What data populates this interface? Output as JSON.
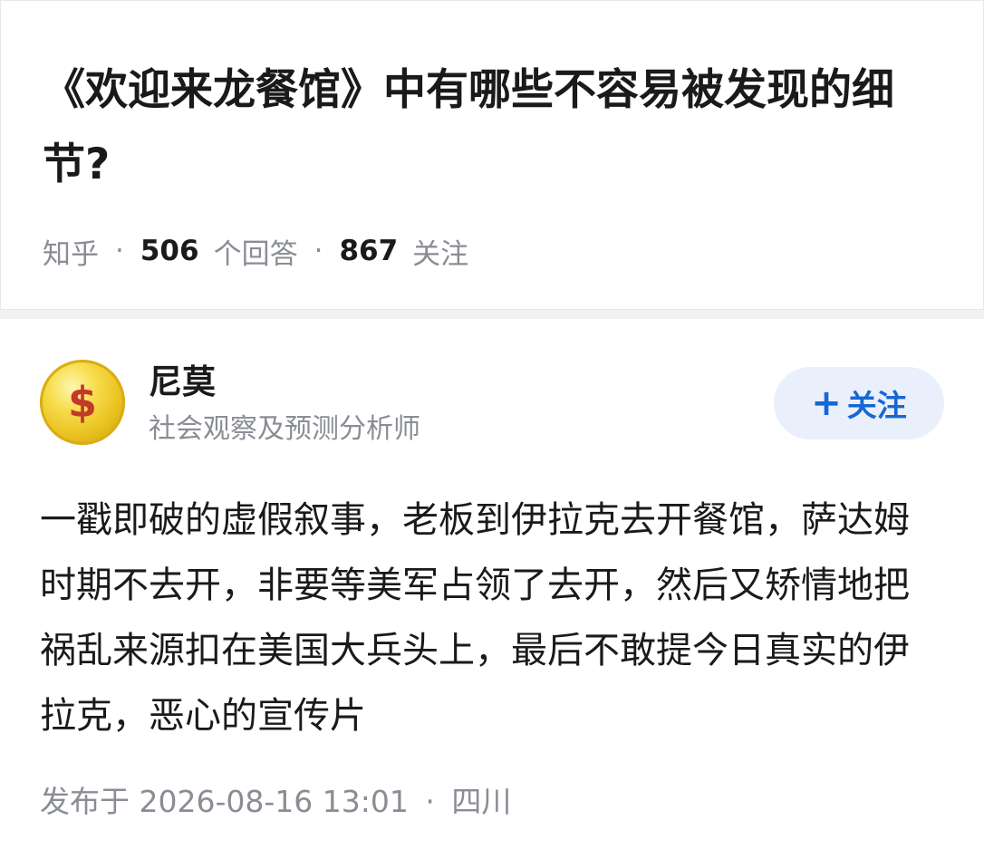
{
  "question": {
    "title": "《欢迎来龙餐馆》中有哪些不容易被发现的细节?",
    "source": "知乎",
    "separator": "·",
    "answer_count": "506",
    "answer_label": "个回答",
    "follow_count": "867",
    "follow_label": "关注"
  },
  "answer": {
    "avatar_icon": "dollar-coin-icon",
    "avatar_glyph": "$",
    "author_name": "尼莫",
    "author_bio": "社会观察及预测分析师",
    "follow_button": {
      "plus": "+",
      "label": "关注"
    },
    "content": "一戳即破的虚假叙事，老板到伊拉克去开餐馆，萨达姆时期不去开，非要等美军占领了去开，然后又矫情地把祸乱来源扣在美国大兵头上，最后不敢提今日真实的伊拉克，恶心的宣传片",
    "published": "发布于 2026-08-16 13:01",
    "location_separator": "·",
    "location": "四川"
  },
  "colors": {
    "accent": "#1766d6",
    "follow_button_bg": "#e9f0fb",
    "secondary_text": "#8a8d94",
    "primary_text": "#1a1a1a",
    "page_background": "#f0f1f3"
  }
}
